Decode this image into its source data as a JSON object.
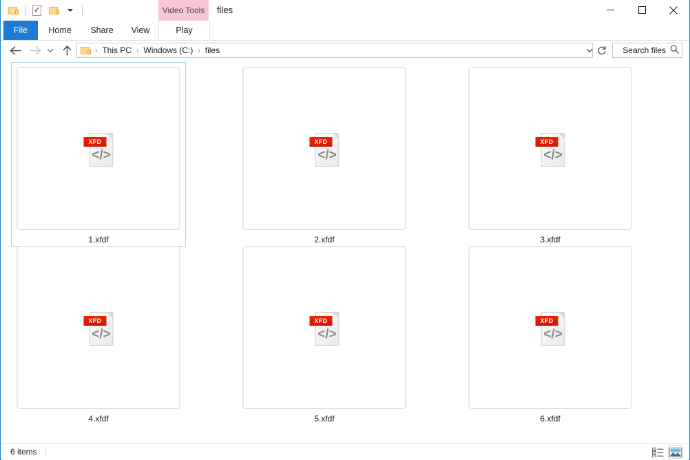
{
  "window": {
    "title": "files",
    "tool_group_label": "Video Tools",
    "caption": {
      "minimize": "minimize-button",
      "maximize": "maximize-button",
      "close": "close-button"
    }
  },
  "quick_access": {
    "items": [
      {
        "name": "folder-icon",
        "label": ""
      },
      {
        "name": "properties-icon",
        "label": ""
      },
      {
        "name": "new-folder-icon",
        "label": ""
      },
      {
        "name": "customize-dropdown",
        "label": ""
      }
    ]
  },
  "ribbon": {
    "tabs": [
      {
        "label": "File",
        "active": true
      },
      {
        "label": "Home",
        "active": false
      },
      {
        "label": "Share",
        "active": false
      },
      {
        "label": "View",
        "active": false
      },
      {
        "label": "Play",
        "active": false
      }
    ],
    "expand_label": "",
    "help_label": "?"
  },
  "address": {
    "back_label": "",
    "forward_label": "",
    "recent_label": "",
    "up_label": "",
    "breadcrumbs": [
      "This PC",
      "Windows (C:)",
      "files"
    ],
    "separator": "›",
    "dropdown_label": "",
    "refresh_label": ""
  },
  "search": {
    "placeholder": "Search files",
    "value": ""
  },
  "files": [
    {
      "name": "1.xfdf",
      "badge": "XFD",
      "selected": true
    },
    {
      "name": "2.xfdf",
      "badge": "XFD",
      "selected": false
    },
    {
      "name": "3.xfdf",
      "badge": "XFD",
      "selected": false
    },
    {
      "name": "4.xfdf",
      "badge": "XFD",
      "selected": false
    },
    {
      "name": "5.xfdf",
      "badge": "XFD",
      "selected": false
    },
    {
      "name": "6.xfdf",
      "badge": "XFD",
      "selected": false
    }
  ],
  "icon_glyph": {
    "code_symbol": "</>"
  },
  "status": {
    "count_label": "6 items",
    "views": [
      {
        "name": "details-view-button",
        "active": false
      },
      {
        "name": "large-icons-view-button",
        "active": true
      }
    ]
  },
  "colors": {
    "accent": "#1e7ad2",
    "window_border": "#1883d7",
    "contextual_tab": "#f6c5d8",
    "badge_red": "#d61400",
    "selection_border": "#a5d3f2"
  }
}
